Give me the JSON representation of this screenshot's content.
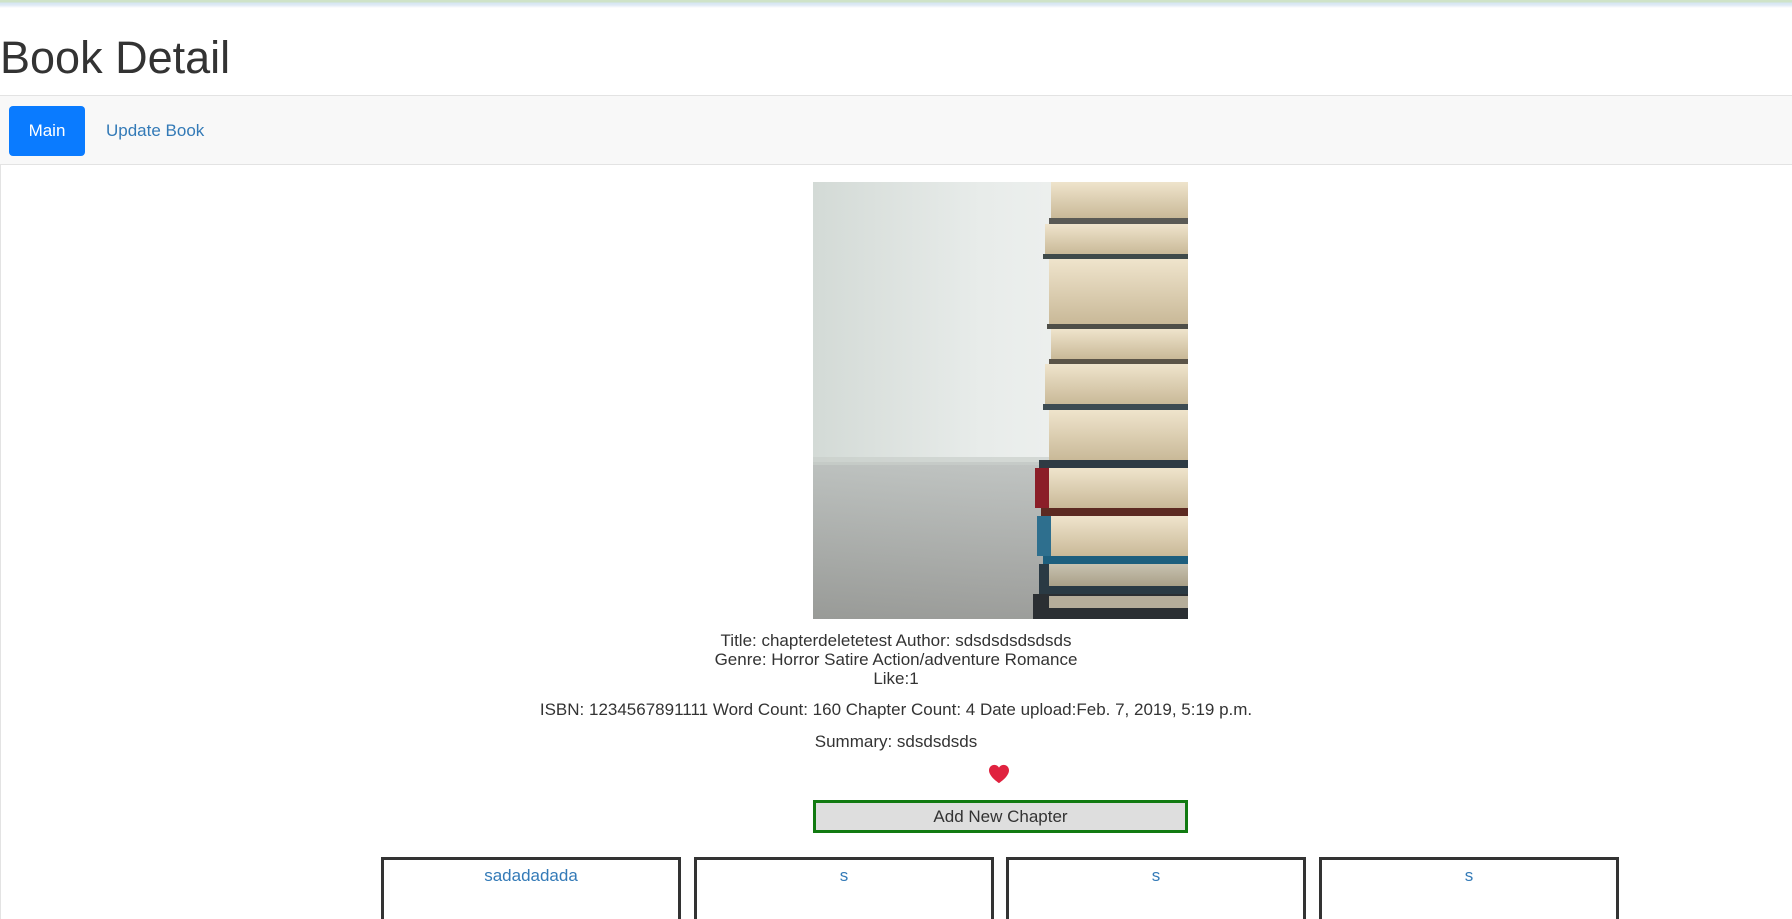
{
  "page": {
    "title": "Book Detail"
  },
  "nav": {
    "main_label": "Main",
    "update_label": "Update Book"
  },
  "book": {
    "line1": "Title: chapterdeletetest Author: sdsdsdsdsdsds",
    "line2": "Genre: Horror Satire Action/adventure Romance",
    "line3": "Like:1",
    "details": "ISBN: 1234567891111 Word Count: 160 Chapter Count: 4 Date upload:Feb. 7, 2019, 5:19 p.m.",
    "summary": "Summary: sdsdsdsds"
  },
  "actions": {
    "add_chapter_label": "Add New Chapter"
  },
  "chapters": [
    {
      "title": "sadadadada"
    },
    {
      "title": "s"
    },
    {
      "title": "s"
    },
    {
      "title": "s"
    }
  ],
  "colors": {
    "primary": "#0a7bff",
    "link": "#337ab7",
    "heart": "#e0223f",
    "add_border": "#117a11"
  },
  "icons": {
    "like": "heart-icon"
  }
}
